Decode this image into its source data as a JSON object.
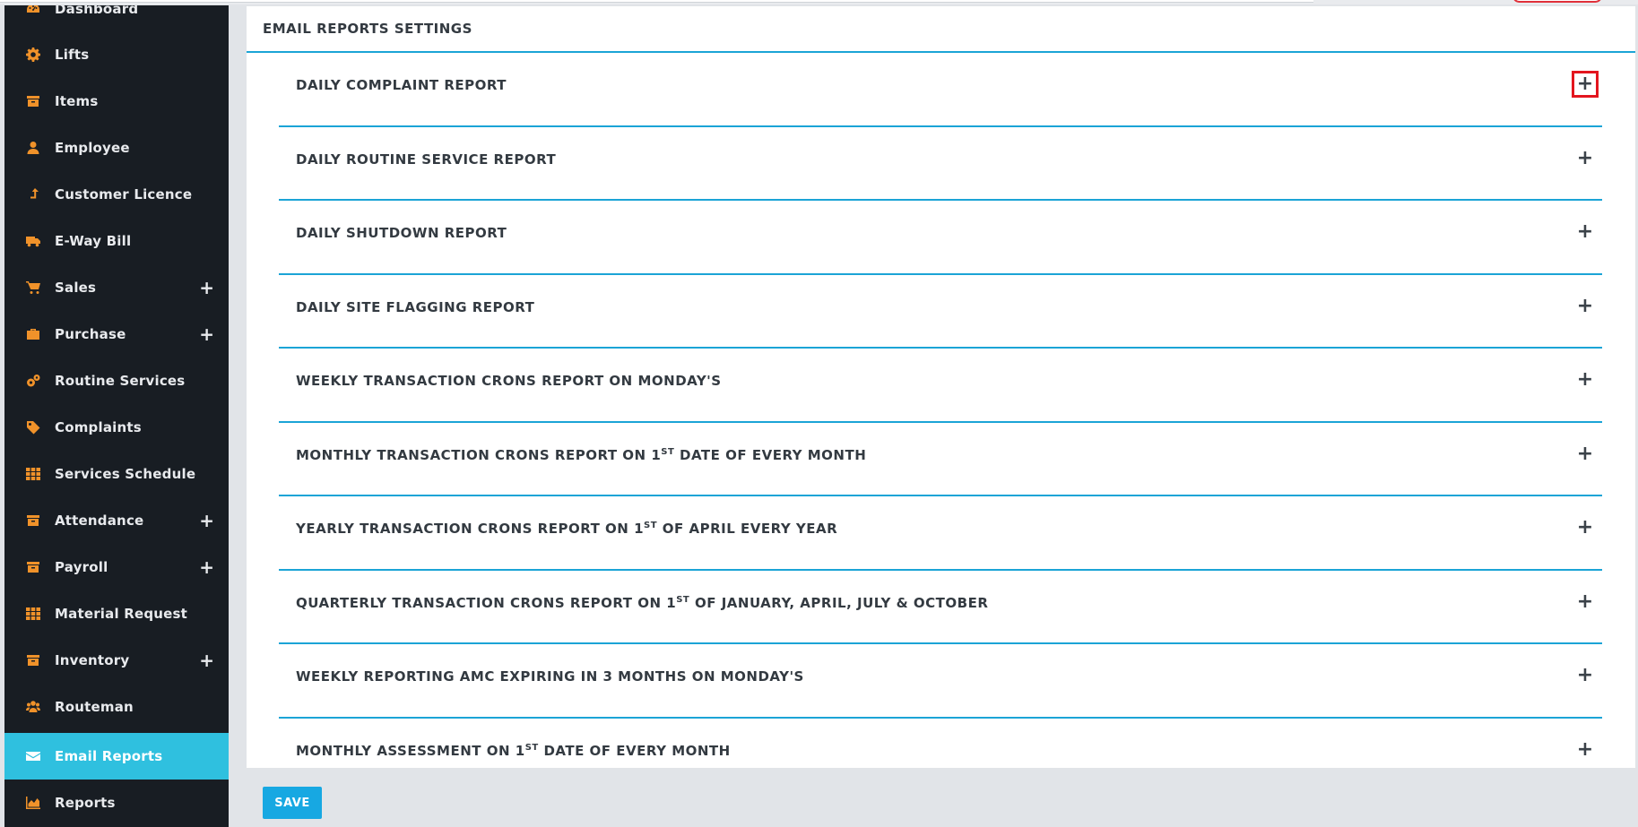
{
  "sidebar": {
    "items": [
      {
        "label": "Dashboard",
        "icon": "dashboard-icon"
      },
      {
        "label": "Lifts",
        "icon": "gear-icon"
      },
      {
        "label": "Items",
        "icon": "archive-box-icon"
      },
      {
        "label": "Employee",
        "icon": "user-icon"
      },
      {
        "label": "Customer Licence",
        "icon": "arrow-up-icon"
      },
      {
        "label": "E-Way Bill",
        "icon": "truck-icon"
      },
      {
        "label": "Sales",
        "icon": "cart-icon",
        "expand": "+"
      },
      {
        "label": "Purchase",
        "icon": "briefcase-icon",
        "expand": "+"
      },
      {
        "label": "Routine Services",
        "icon": "gears-icon"
      },
      {
        "label": "Complaints",
        "icon": "tag-icon"
      },
      {
        "label": "Services Schedule",
        "icon": "grid-icon"
      },
      {
        "label": "Attendance",
        "icon": "archive-box-icon",
        "expand": "+"
      },
      {
        "label": "Payroll",
        "icon": "archive-box-icon",
        "expand": "+"
      },
      {
        "label": "Material Request",
        "icon": "grid-icon"
      },
      {
        "label": "Inventory",
        "icon": "archive-box-icon",
        "expand": "+"
      },
      {
        "label": "Routeman",
        "icon": "users-icon"
      },
      {
        "label": "Email Reports",
        "icon": "envelope-icon",
        "active": true
      },
      {
        "label": "Reports",
        "icon": "area-chart-icon"
      }
    ]
  },
  "main": {
    "title": "EMAIL REPORTS SETTINGS",
    "reports": [
      {
        "pre": "DAILY COMPLAINT REPORT",
        "sup": "",
        "post": "",
        "toggle": "+"
      },
      {
        "pre": "DAILY ROUTINE SERVICE REPORT",
        "sup": "",
        "post": "",
        "toggle": "+"
      },
      {
        "pre": "DAILY SHUTDOWN REPORT",
        "sup": "",
        "post": "",
        "toggle": "+"
      },
      {
        "pre": "DAILY SITE FLAGGING REPORT",
        "sup": "",
        "post": "",
        "toggle": "+"
      },
      {
        "pre": "WEEKLY TRANSACTION CRONS REPORT ON MONDAY'S",
        "sup": "",
        "post": "",
        "toggle": "+"
      },
      {
        "pre": "MONTHLY TRANSACTION CRONS REPORT ON 1",
        "sup": "ST",
        "post": " DATE OF EVERY MONTH",
        "toggle": "+"
      },
      {
        "pre": "YEARLY TRANSACTION CRONS REPORT ON 1",
        "sup": "ST",
        "post": " OF APRIL EVERY YEAR",
        "toggle": "+"
      },
      {
        "pre": "QUARTERLY TRANSACTION CRONS REPORT ON 1",
        "sup": "ST",
        "post": " OF JANUARY, APRIL, JULY & OCTOBER",
        "toggle": "+"
      },
      {
        "pre": "WEEKLY REPORTING AMC EXPIRING IN 3 MONTHS ON MONDAY'S",
        "sup": "",
        "post": "",
        "toggle": "+"
      },
      {
        "pre": "MONTHLY ASSESSMENT ON 1",
        "sup": "ST",
        "post": " DATE OF EVERY MONTH",
        "toggle": "+"
      }
    ],
    "save_label": "SAVE"
  },
  "colors": {
    "sidebar_bg": "#181d23",
    "sidebar_icon": "#f0922a",
    "active_bg": "#2fc0df",
    "divider": "#1ba4d6",
    "save_button": "#17a8e2",
    "highlight_box": "#e3151e"
  }
}
